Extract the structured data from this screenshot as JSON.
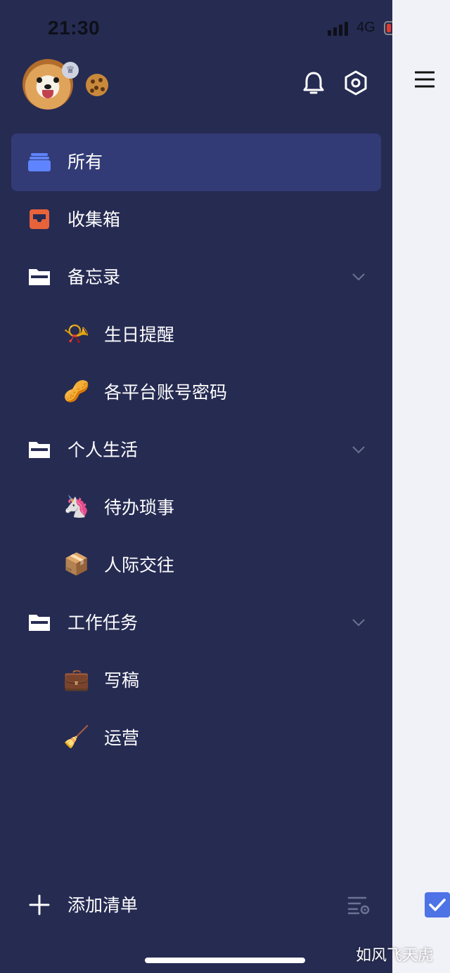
{
  "status_bar": {
    "time": "21:30",
    "network": "4G",
    "battery_level": 0.12
  },
  "profile": {
    "avatar_icon": "shiba-avatar",
    "badge_icon": "crown-icon",
    "status_emoji": "🍪"
  },
  "header": {
    "notification_icon": "bell-icon",
    "settings_icon": "settings-hexagon-icon"
  },
  "menu": {
    "all": {
      "label": "所有",
      "icon": "stack-icon",
      "active": true
    },
    "inbox": {
      "label": "收集箱",
      "icon": "inbox-icon"
    },
    "folders": [
      {
        "label": "备忘录",
        "icon": "folder-icon",
        "lists": [
          {
            "emoji": "📯",
            "label": "生日提醒"
          },
          {
            "emoji": "🥜",
            "label": "各平台账号密码"
          }
        ]
      },
      {
        "label": "个人生活",
        "icon": "folder-icon",
        "lists": [
          {
            "emoji": "🦄",
            "label": "待办琐事"
          },
          {
            "emoji": "📦",
            "label": "人际交往"
          }
        ]
      },
      {
        "label": "工作任务",
        "icon": "folder-icon",
        "lists": [
          {
            "emoji": "💼",
            "label": "写稿"
          },
          {
            "emoji": "🧹",
            "label": "运营"
          }
        ]
      }
    ]
  },
  "bottom": {
    "add_list_label": "添加清单",
    "add_icon": "plus-icon",
    "manage_icon": "list-settings-icon"
  },
  "watermark": "如风飞天虎",
  "colors": {
    "drawer_bg": "#262b52",
    "active_bg": "#323b75",
    "accent_blue": "#4d73e6",
    "inbox_orange": "#e8633a"
  }
}
